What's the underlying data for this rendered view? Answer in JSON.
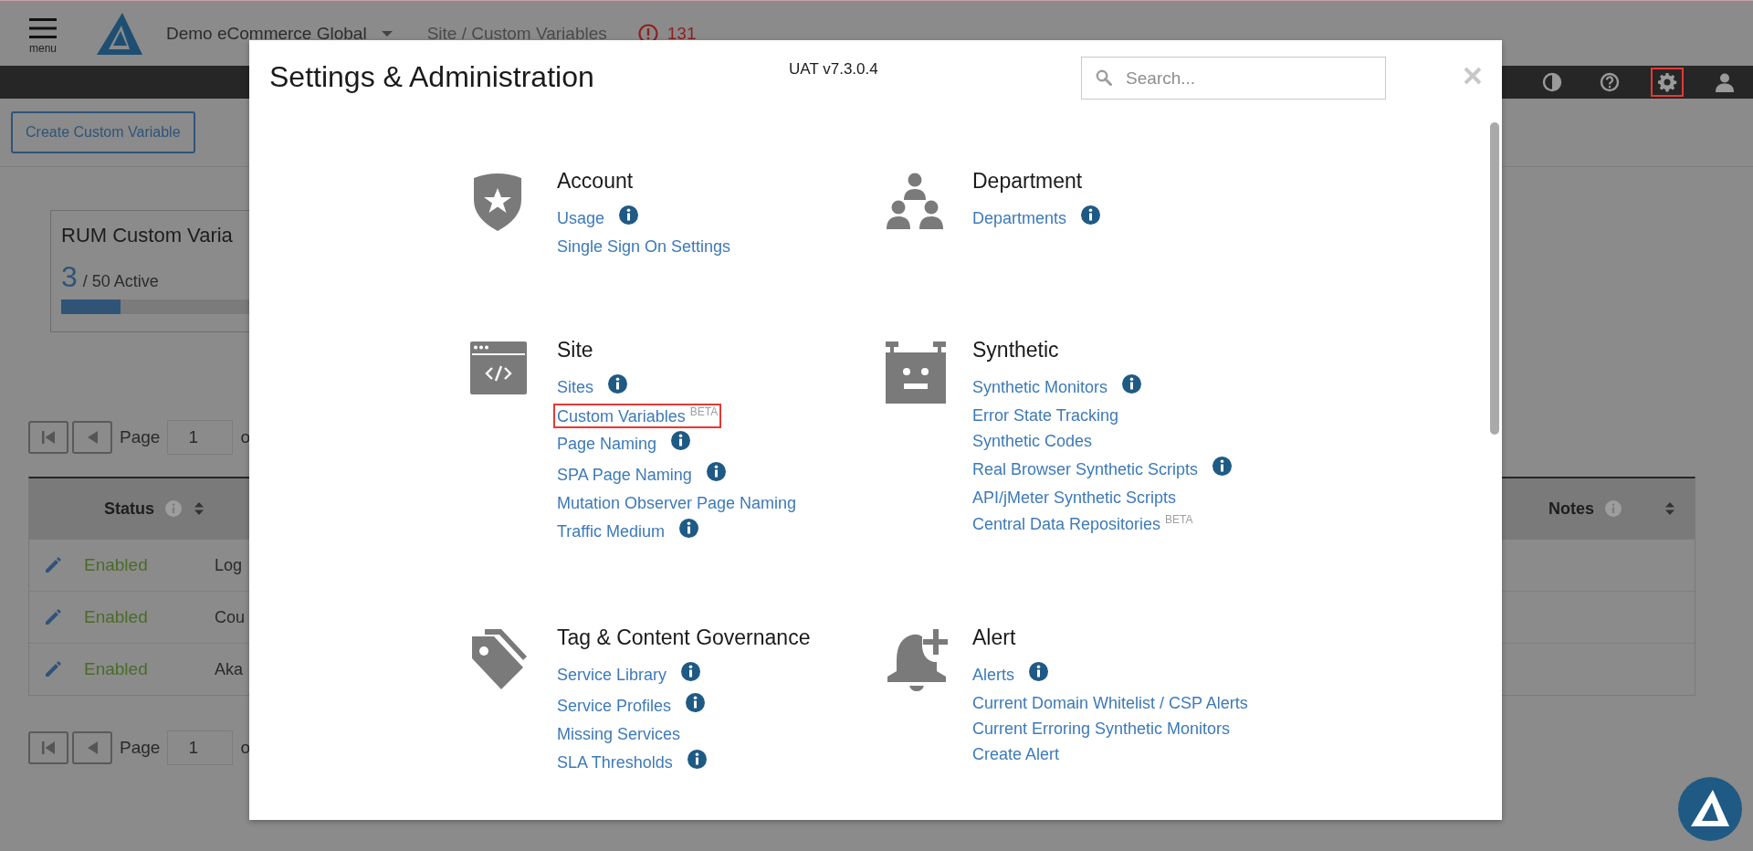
{
  "header": {
    "menu_label": "menu",
    "account": "Demo eCommerce Global",
    "breadcrumb": "Site / Custom Variables",
    "error_count": "131"
  },
  "toolbar_buttons": [
    {
      "selected": false
    },
    {
      "selected": false
    },
    {
      "selected": true
    },
    {
      "selected": false
    }
  ],
  "create_button": "Create Custom Variable",
  "usage_card": {
    "title": "RUM Custom Varia",
    "count": "3",
    "total": "/ 50 Active",
    "level": 0.06
  },
  "pager_top": {
    "label": "Page",
    "value": "1",
    "suffix": "o"
  },
  "table": {
    "columns": [
      {
        "label": "Status",
        "info": true,
        "sortable": true
      },
      {
        "label": "Notes",
        "info": true,
        "sortable": true
      }
    ],
    "rows": [
      {
        "status": "Enabled",
        "name": "Log"
      },
      {
        "status": "Enabled",
        "name": "Cou"
      },
      {
        "status": "Enabled",
        "name": "Aka"
      }
    ]
  },
  "pager_bottom": {
    "label": "Page",
    "value": "1",
    "suffix": "o"
  },
  "modal": {
    "title": "Settings & Administration",
    "version": "UAT v7.3.0.4",
    "search": {
      "placeholder": "Search..."
    },
    "sections": [
      {
        "title": "Account",
        "links": [
          {
            "label": "Usage",
            "info": true
          },
          {
            "label": "Single Sign On Settings",
            "info": false
          }
        ]
      },
      {
        "title": "Department",
        "links": [
          {
            "label": "Departments",
            "info": true
          }
        ]
      },
      {
        "title": "Site",
        "links": [
          {
            "label": "Sites",
            "info": true
          },
          {
            "label": "Custom Variables",
            "info": false,
            "badge": "BETA",
            "highlighted": true
          },
          {
            "label": "Page Naming",
            "info": true
          },
          {
            "label": "SPA Page Naming",
            "info": true
          },
          {
            "label": "Mutation Observer Page Naming",
            "info": false
          },
          {
            "label": "Traffic Medium",
            "info": true
          }
        ]
      },
      {
        "title": "Synthetic",
        "links": [
          {
            "label": "Synthetic Monitors",
            "info": true
          },
          {
            "label": "Error State Tracking",
            "info": false
          },
          {
            "label": "Synthetic Codes",
            "info": false
          },
          {
            "label": "Real Browser Synthetic Scripts",
            "info": true
          },
          {
            "label": "API/jMeter Synthetic Scripts",
            "info": false
          },
          {
            "label": "Central Data Repositories",
            "info": false,
            "badge": "BETA"
          }
        ]
      },
      {
        "title": "Tag & Content Governance",
        "links": [
          {
            "label": "Service Library",
            "info": true
          },
          {
            "label": "Service Profiles",
            "info": true
          },
          {
            "label": "Missing Services",
            "info": false
          },
          {
            "label": "SLA Thresholds",
            "info": true
          }
        ]
      },
      {
        "title": "Alert",
        "links": [
          {
            "label": "Alerts",
            "info": true
          },
          {
            "label": "Current Domain Whitelist / CSP Alerts",
            "info": false
          },
          {
            "label": "Current Erroring Synthetic Monitors",
            "info": false
          },
          {
            "label": "Create Alert",
            "info": false
          }
        ]
      }
    ]
  }
}
